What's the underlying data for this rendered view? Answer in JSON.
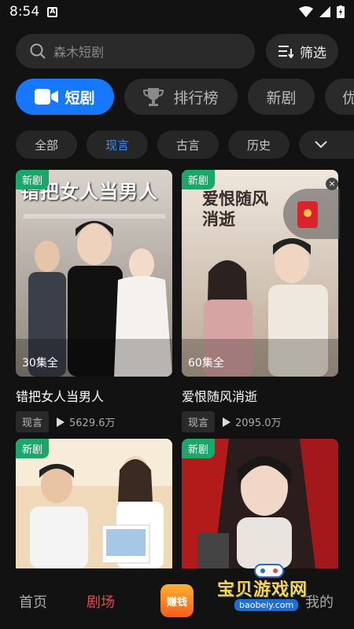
{
  "status": {
    "time": "8:54",
    "a_label": "A"
  },
  "search": {
    "placeholder": "森木短剧"
  },
  "filter": {
    "label": "筛选"
  },
  "tabs": [
    {
      "label": "短剧",
      "active": true
    },
    {
      "label": "排行榜"
    },
    {
      "label": "新剧"
    },
    {
      "label": "优"
    }
  ],
  "chips": [
    {
      "label": "全部"
    },
    {
      "label": "现言",
      "active": true
    },
    {
      "label": "古言"
    },
    {
      "label": "历史"
    }
  ],
  "cards": [
    {
      "badge": "新剧",
      "episodes": "30集全",
      "title": "错把女人当男人",
      "tag": "现言",
      "plays": "5629.6万",
      "poster_text": "错把女人当男人"
    },
    {
      "badge": "新剧",
      "episodes": "60集全",
      "title": "爱恨随风消逝",
      "tag": "现言",
      "plays": "2095.0万",
      "poster_text": "爱恨随风消逝"
    },
    {
      "badge": "新剧"
    },
    {
      "badge": "新剧"
    }
  ],
  "bottom_nav": {
    "home": "首页",
    "theater": "剧场",
    "earn": "赚钱",
    "mine": "我的"
  },
  "watermark": {
    "text": "宝贝游戏网",
    "url": "baobeiy.com"
  },
  "colors": {
    "accent": "#1677ff",
    "active_nav": "#e5484d",
    "badge": "#1aa86a"
  }
}
